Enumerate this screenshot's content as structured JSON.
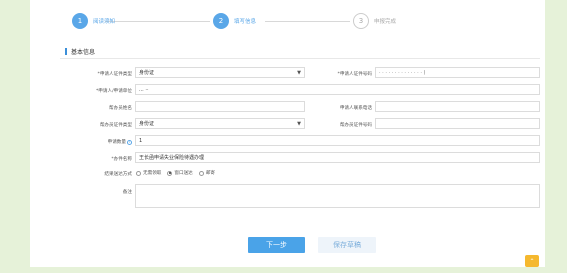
{
  "steps": [
    {
      "num": "1",
      "label": "阅读须知"
    },
    {
      "num": "2",
      "label": "填写信息"
    },
    {
      "num": "3",
      "label": "申报完成"
    }
  ],
  "section_title": "基本信息",
  "form": {
    "applicant_id_type_label": "*申请人证件类型",
    "applicant_id_type_value": "身份证",
    "applicant_id_no_label": "*申请人证件号码",
    "applicant_id_no_value": "· · · · · · · · · · · · · · )",
    "applicant_name_label": "*申请人/申请单位",
    "applicant_name_value": "...  ··",
    "helper_name_label": "帮办员姓名",
    "helper_name_value": "",
    "helper_phone_label": "申请人联系电话",
    "helper_phone_value": "",
    "helper_id_type_label": "帮办员证件类型",
    "helper_id_type_value": "身份证",
    "helper_id_no_label": "帮办员证件号码",
    "helper_id_no_value": "",
    "quantity_label": "申请数量",
    "quantity_info": "i",
    "quantity_value": "1",
    "item_name_label": "*办件名称",
    "item_name_value": "王长函申请失业保险待遇办理",
    "delivery_label": "结果送达方式",
    "delivery_options": [
      "无需领取",
      "窗口送达",
      "邮寄"
    ],
    "delivery_selected_index": 1,
    "remarks_label": "备注",
    "remarks_value": ""
  },
  "buttons": {
    "next": "下一步",
    "save_draft": "保存草稿"
  },
  "corner_icon_glyph": "⌃"
}
